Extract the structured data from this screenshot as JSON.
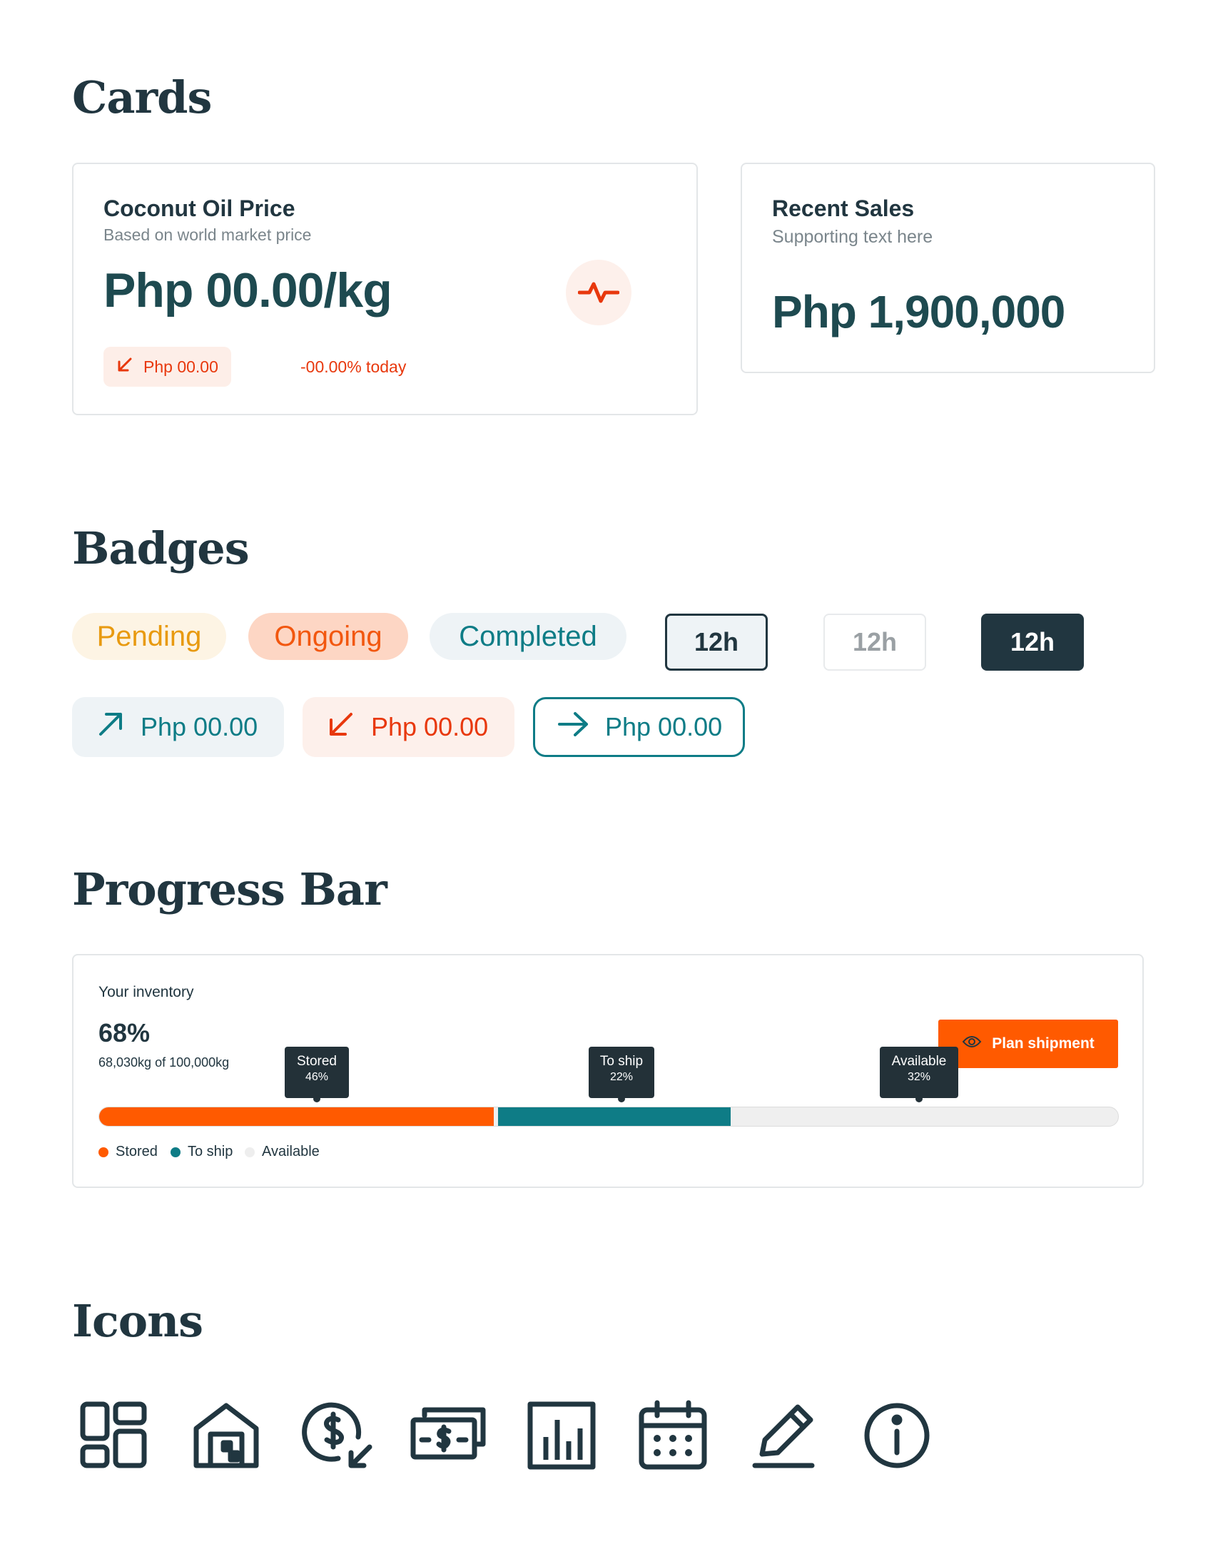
{
  "sections": {
    "cards": "Cards",
    "badges": "Badges",
    "progress": "Progress Bar",
    "icons": "Icons"
  },
  "colors": {
    "dark": "#213640",
    "teal": "#0e7c86",
    "orange": "#ff5a00",
    "red": "#e8380d",
    "pending": "#e89a10",
    "border": "#e3e6e8"
  },
  "coconut_card": {
    "title": "Coconut Oil Price",
    "subtitle": "Based on world market price",
    "value": "Php 00.00/kg",
    "change_value": "Php 00.00",
    "change_percent": "-00.00% today",
    "icon": "activity-pulse-icon"
  },
  "sales_card": {
    "title": "Recent Sales",
    "subtitle": "Supporting text here",
    "value": "Php 1,900,000"
  },
  "badges": {
    "status": [
      "Pending",
      "Ongoing",
      "Completed"
    ],
    "time": [
      "12h",
      "12h",
      "12h"
    ],
    "trends": [
      {
        "label": "Php 00.00",
        "icon": "arrow-up-right-icon"
      },
      {
        "label": "Php 00.00",
        "icon": "arrow-down-left-icon"
      },
      {
        "label": "Php 00.00",
        "icon": "arrow-right-icon"
      }
    ]
  },
  "inventory": {
    "label": "Your inventory",
    "percent": "68%",
    "detail": "68,030kg of 100,000kg",
    "button_label": "Plan shipment",
    "button_icon": "eye-icon",
    "segments": [
      {
        "name": "Stored",
        "percent": "46%",
        "share": 0.387
      },
      {
        "name": "To ship",
        "percent": "22%",
        "share": 0.232
      },
      {
        "name": "Available",
        "percent": "32%",
        "share": 0.381
      }
    ],
    "legend": [
      "Stored",
      "To ship",
      "Available"
    ]
  },
  "icons": [
    "dashboard-icon",
    "warehouse-icon",
    "dollar-receive-icon",
    "cash-icon",
    "bar-chart-icon",
    "calendar-icon",
    "pencil-icon",
    "info-icon"
  ]
}
